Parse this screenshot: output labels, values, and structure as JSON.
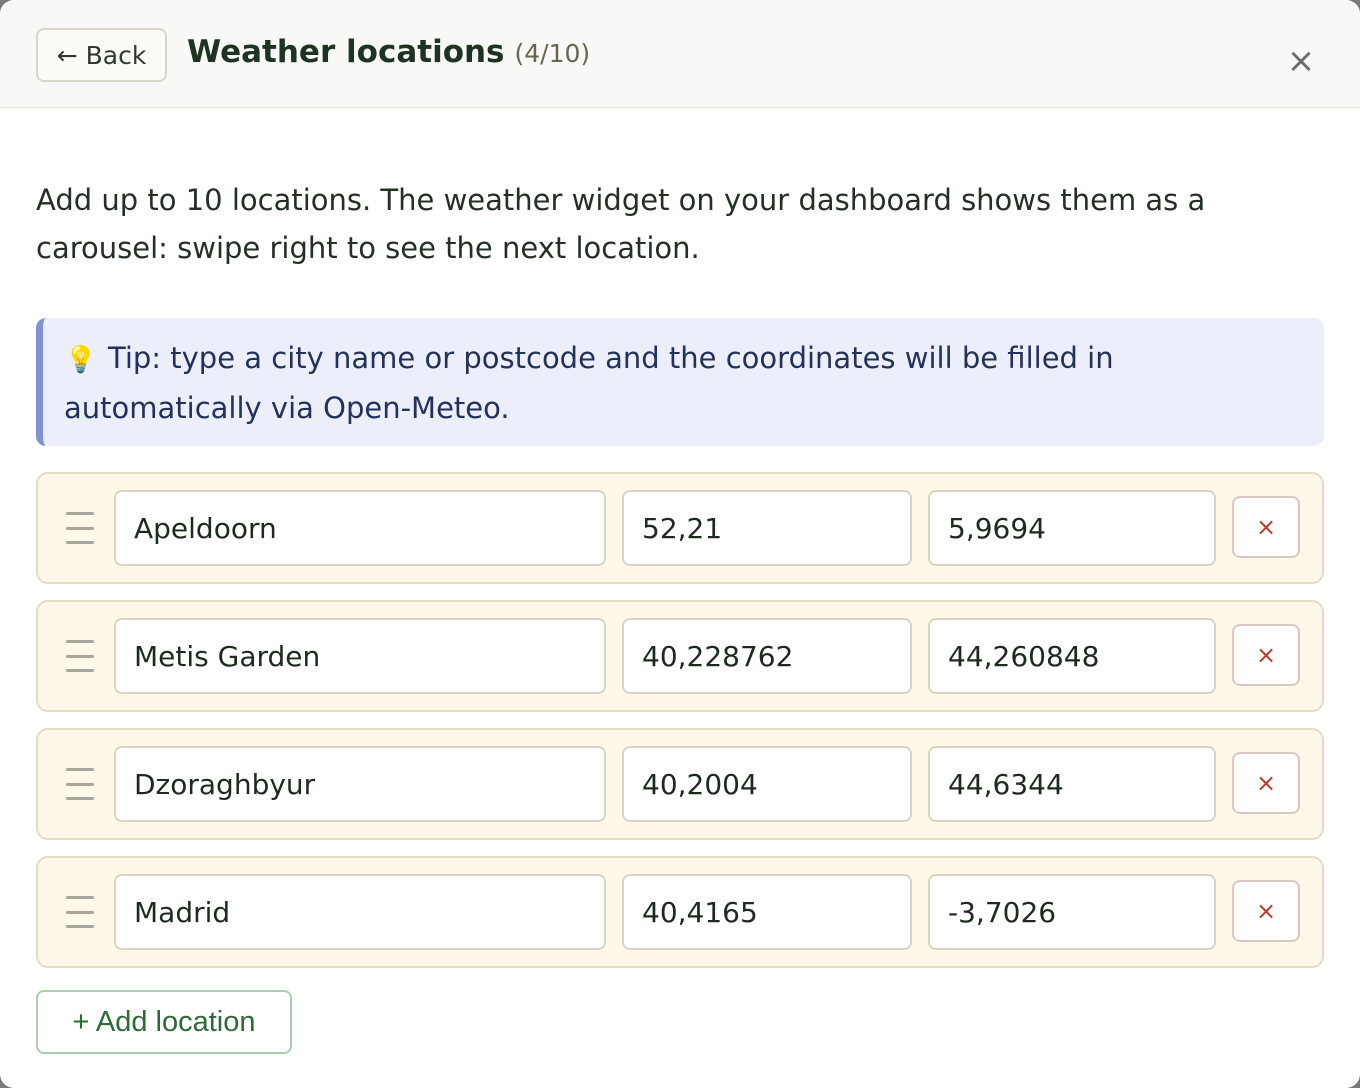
{
  "header": {
    "back_label": "← Back",
    "title": "Weather locations",
    "count": "(4/10)",
    "close_label": "×"
  },
  "intro": "Add up to 10 locations. The weather widget on your dashboard shows them as a carousel: swipe right to see the next location.",
  "tip": {
    "icon": "lightbulb-icon",
    "text": "Tip: type a city name or postcode and the coordinates will be filled in automatically via Open-Meteo."
  },
  "locations": [
    {
      "name": "Apeldoorn",
      "lat": "52,21",
      "lon": "5,9694"
    },
    {
      "name": "Metis Garden",
      "lat": "40,228762",
      "lon": "44,260848"
    },
    {
      "name": "Dzoraghbyur",
      "lat": "40,2004",
      "lon": "44,6344"
    },
    {
      "name": "Madrid",
      "lat": "40,4165",
      "lon": "-3,7026"
    }
  ],
  "remove_label": "×",
  "add_label": "+ Add location",
  "colors": {
    "accent_green": "#2c6b36",
    "row_bg": "#fef8e8",
    "tip_bg": "#eceff9",
    "tip_border": "#7d93d4",
    "remove_red": "#c0392b"
  }
}
